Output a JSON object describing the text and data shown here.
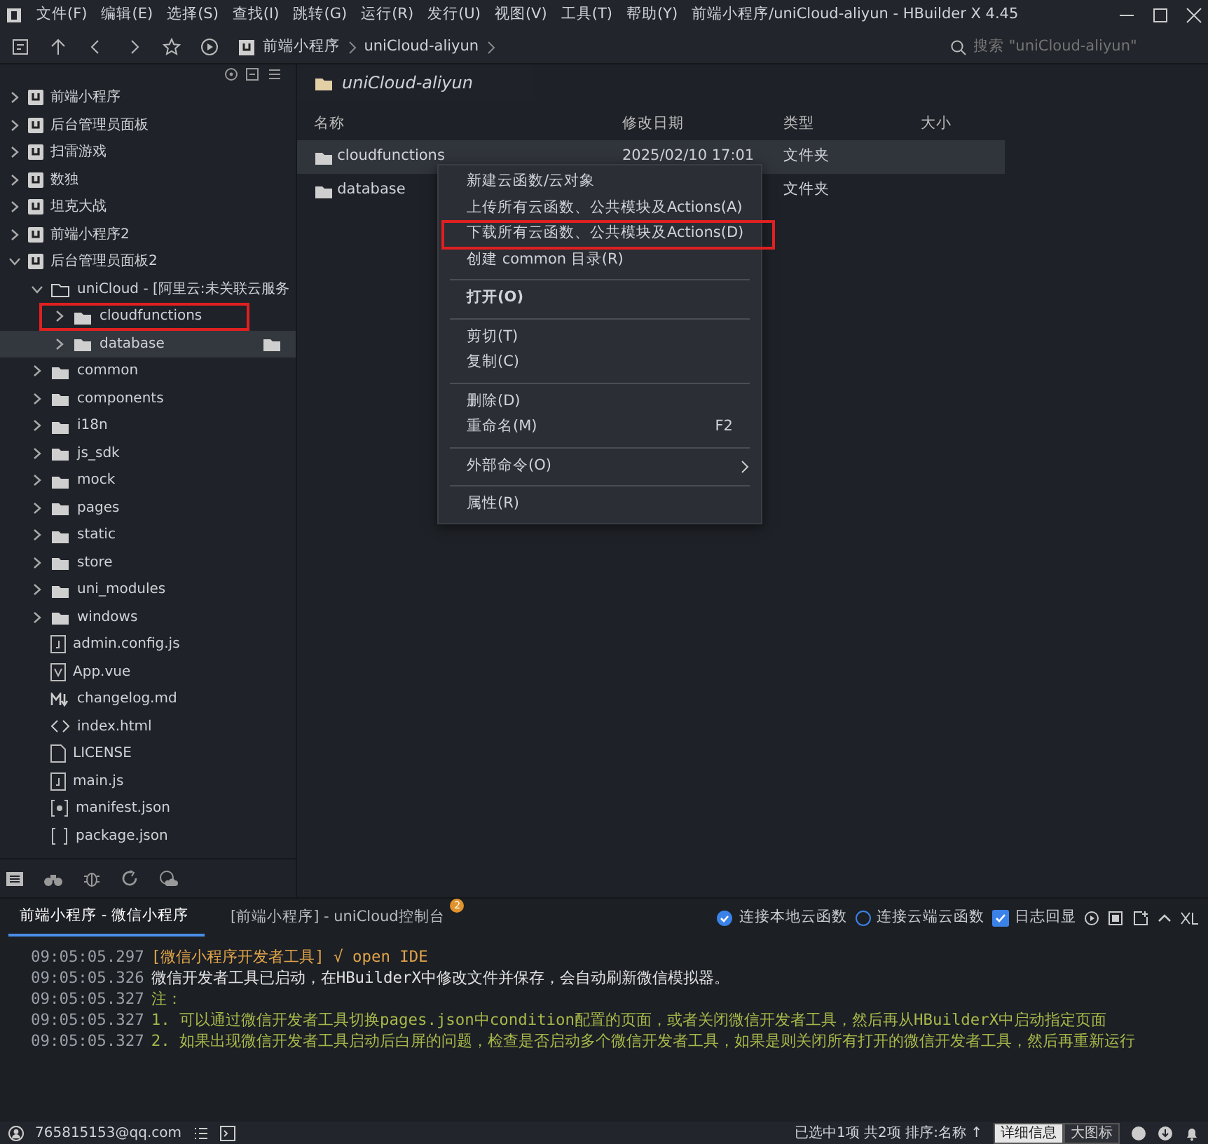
{
  "window": {
    "title": "前端小程序/uniCloud-aliyun - HBuilder X 4.45"
  },
  "menu": [
    "文件(F)",
    "编辑(E)",
    "选择(S)",
    "查找(I)",
    "跳转(G)",
    "运行(R)",
    "发行(U)",
    "视图(V)",
    "工具(T)",
    "帮助(Y)"
  ],
  "breadcrumb": [
    "前端小程序",
    "uniCloud-aliyun"
  ],
  "search": {
    "placeholder": "搜索 \"uniCloud-aliyun\""
  },
  "tree": [
    {
      "label": "前端小程序",
      "kind": "project",
      "expanded": false,
      "selected": false,
      "annotated": false
    },
    {
      "label": "后台管理员面板",
      "kind": "project",
      "expanded": false,
      "selected": false,
      "annotated": false
    },
    {
      "label": "扫雷游戏",
      "kind": "project",
      "expanded": false,
      "selected": false,
      "annotated": false
    },
    {
      "label": "数独",
      "kind": "project",
      "expanded": false,
      "selected": false,
      "annotated": false
    },
    {
      "label": "坦克大战",
      "kind": "project",
      "expanded": false,
      "selected": false,
      "annotated": false
    },
    {
      "label": "前端小程序2",
      "kind": "project",
      "expanded": false,
      "selected": false,
      "annotated": false
    },
    {
      "label": "后台管理员面板2",
      "kind": "project",
      "expanded": true,
      "selected": false,
      "annotated": false,
      "children": [
        {
          "label": "uniCloud - [阿里云:未关联云服务",
          "kind": "cloud",
          "expanded": true,
          "selected": false,
          "annotated": false,
          "children": [
            {
              "label": "cloudfunctions",
              "kind": "folder",
              "expanded": false,
              "selected": false,
              "annotated": true
            },
            {
              "label": "database",
              "kind": "folder",
              "expanded": false,
              "selected": true,
              "annotated": false
            }
          ]
        },
        {
          "label": "common",
          "kind": "folder",
          "expanded": false,
          "selected": false,
          "annotated": false
        },
        {
          "label": "components",
          "kind": "folder",
          "expanded": false,
          "selected": false,
          "annotated": false
        },
        {
          "label": "i18n",
          "kind": "folder",
          "expanded": false,
          "selected": false,
          "annotated": false
        },
        {
          "label": "js_sdk",
          "kind": "folder",
          "expanded": false,
          "selected": false,
          "annotated": false
        },
        {
          "label": "mock",
          "kind": "folder",
          "expanded": false,
          "selected": false,
          "annotated": false
        },
        {
          "label": "pages",
          "kind": "folder",
          "expanded": false,
          "selected": false,
          "annotated": false
        },
        {
          "label": "static",
          "kind": "folder",
          "expanded": false,
          "selected": false,
          "annotated": false
        },
        {
          "label": "store",
          "kind": "folder",
          "expanded": false,
          "selected": false,
          "annotated": false
        },
        {
          "label": "uni_modules",
          "kind": "folder",
          "expanded": false,
          "selected": false,
          "annotated": false
        },
        {
          "label": "windows",
          "kind": "folder",
          "expanded": false,
          "selected": false,
          "annotated": false
        },
        {
          "label": "admin.config.js",
          "kind": "js",
          "selected": false,
          "annotated": false
        },
        {
          "label": "App.vue",
          "kind": "vue",
          "selected": false,
          "annotated": false
        },
        {
          "label": "changelog.md",
          "kind": "md",
          "selected": false,
          "annotated": false
        },
        {
          "label": "index.html",
          "kind": "html",
          "selected": false,
          "annotated": false
        },
        {
          "label": "LICENSE",
          "kind": "file",
          "selected": false,
          "annotated": false
        },
        {
          "label": "main.js",
          "kind": "js",
          "selected": false,
          "annotated": false
        },
        {
          "label": "manifest.json",
          "kind": "manifest",
          "selected": false,
          "annotated": false
        },
        {
          "label": "package.json",
          "kind": "json",
          "selected": false,
          "annotated": false
        }
      ]
    }
  ],
  "editor_tab": {
    "label": "uniCloud-aliyun"
  },
  "file_list": {
    "columns": [
      "名称",
      "修改日期",
      "类型",
      "大小"
    ],
    "rows": [
      {
        "name": "cloudfunctions",
        "date": "2025/02/10 17:01",
        "type": "文件夹",
        "selected": true
      },
      {
        "name": "database",
        "type": "文件夹",
        "selected": false
      }
    ]
  },
  "context_menu": [
    {
      "kind": "item",
      "label": "新建云函数/云对象",
      "default": false,
      "submenu": false,
      "annotated": false
    },
    {
      "kind": "item",
      "label": "上传所有云函数、公共模块及Actions(A)",
      "default": false,
      "submenu": false,
      "annotated": false
    },
    {
      "kind": "item",
      "label": "下载所有云函数、公共模块及Actions(D)",
      "default": false,
      "submenu": false,
      "annotated": true
    },
    {
      "kind": "item",
      "label": "创建 common 目录(R)",
      "default": false,
      "submenu": false,
      "annotated": false
    },
    {
      "kind": "separator"
    },
    {
      "kind": "item",
      "label": "打开(O)",
      "default": true,
      "submenu": false,
      "annotated": false
    },
    {
      "kind": "separator"
    },
    {
      "kind": "item",
      "label": "剪切(T)",
      "default": false,
      "submenu": false,
      "annotated": false
    },
    {
      "kind": "item",
      "label": "复制(C)",
      "default": false,
      "submenu": false,
      "annotated": false
    },
    {
      "kind": "separator"
    },
    {
      "kind": "item",
      "label": "删除(D)",
      "default": false,
      "submenu": false,
      "annotated": false
    },
    {
      "kind": "item",
      "label": "重命名(M)",
      "shortcut": "F2",
      "default": false,
      "submenu": false,
      "annotated": false
    },
    {
      "kind": "separator"
    },
    {
      "kind": "item",
      "label": "外部命令(O)",
      "default": false,
      "submenu": true,
      "annotated": false
    },
    {
      "kind": "separator"
    },
    {
      "kind": "item",
      "label": "属性(R)",
      "default": false,
      "submenu": false,
      "annotated": false
    }
  ],
  "console": {
    "tabs": [
      {
        "label": "前端小程序 - 微信小程序",
        "selected": true
      },
      {
        "label": "[前端小程序] - uniCloud控制台",
        "selected": false,
        "badge": "2"
      }
    ],
    "options": [
      {
        "kind": "radio",
        "label": "连接本地云函数",
        "checked": true
      },
      {
        "kind": "radio",
        "label": "连接云端云函数",
        "checked": false
      },
      {
        "kind": "checkbox",
        "label": "日志回显",
        "checked": true
      }
    ],
    "lines": [
      {
        "time": "09:05:05.297",
        "text": "[微信小程序开发者工具] √ open IDE",
        "kind": "tool"
      },
      {
        "time": "09:05:05.326",
        "text": "微信开发者工具已启动，在HBuilderX中修改文件并保存，会自动刷新微信模拟器。",
        "kind": "info"
      },
      {
        "time": "09:05:05.327",
        "text": "注：",
        "kind": "note"
      },
      {
        "time": "09:05:05.327",
        "text": "1. 可以通过微信开发者工具切换pages.json中condition配置的页面，或者关闭微信开发者工具，然后再从HBuilderX中启动指定页面",
        "kind": "note"
      },
      {
        "time": "09:05:05.327",
        "text": "2. 如果出现微信开发者工具启动后白屏的问题，检查是否启动多个微信开发者工具，如果是则关闭所有打开的微信开发者工具，然后再重新运行",
        "kind": "note"
      }
    ]
  },
  "status_bar": {
    "account": "765815153@qq.com",
    "summary": "已选中1项 共2项 排序:名称 ↑",
    "views": [
      {
        "label": "详细信息",
        "selected": true
      },
      {
        "label": "大图标",
        "selected": false
      }
    ]
  }
}
